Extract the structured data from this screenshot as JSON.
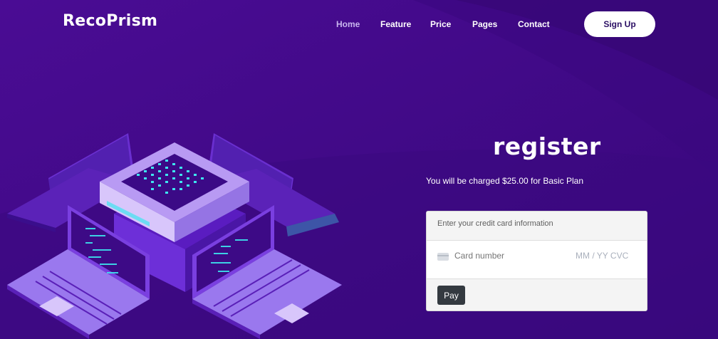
{
  "brand": {
    "name": "RecoPrism"
  },
  "nav": {
    "items": [
      {
        "label": "Home"
      },
      {
        "label": "Feature"
      },
      {
        "label": "Price"
      },
      {
        "label": "Pages"
      },
      {
        "label": "Contact"
      }
    ],
    "signup_label": "Sign Up"
  },
  "hero": {
    "title": "register",
    "charge_text": "You will be charged $25.00 for Basic Plan"
  },
  "payment_card": {
    "header": "Enter your credit card information",
    "card_number_placeholder": "Card number",
    "expiry_cvc_placeholder": "MM / YY  CVC",
    "pay_label": "Pay"
  },
  "colors": {
    "background": "#3d0a85",
    "accent_cyan": "#3ee6ef",
    "illustration_light": "#b89af3",
    "pay_button": "#343a40"
  }
}
